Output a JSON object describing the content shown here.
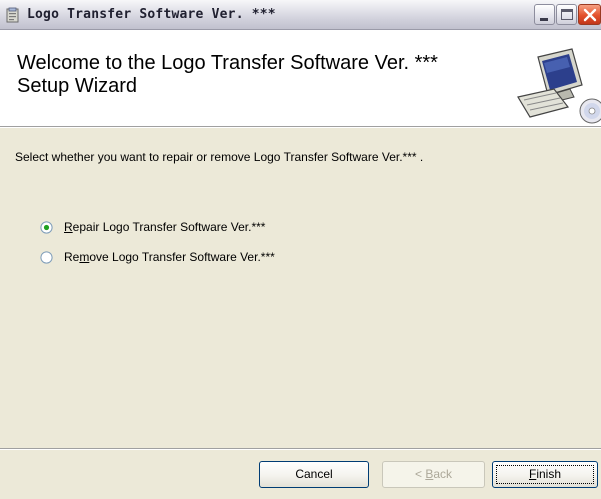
{
  "window": {
    "title": "Logo Transfer Software Ver. ***"
  },
  "titlebar_buttons": {
    "minimize": "minimize-icon",
    "maximize": "maximize-icon",
    "close": "close-icon"
  },
  "banner": {
    "title_line1": "Welcome to the Logo Transfer Software Ver. ***",
    "title_line2": "Setup Wizard",
    "graphic": "computer-setup-icon"
  },
  "body": {
    "instruction": "Select whether you want to repair or remove Logo Transfer Software Ver.*** .",
    "options": [
      {
        "label_pre": "",
        "label_key": "R",
        "label_post": "epair Logo Transfer Software Ver.***",
        "selected": true
      },
      {
        "label_pre": "Re",
        "label_key": "m",
        "label_post": "ove Logo Transfer Software Ver.***",
        "selected": false
      }
    ]
  },
  "footer": {
    "cancel": "Cancel",
    "back_pre": "< ",
    "back_key": "B",
    "back_post": "ack",
    "finish_key": "F",
    "finish_post": "inish"
  },
  "colors": {
    "dialog_bg": "#ece9d8",
    "banner_bg": "#ffffff",
    "button_border": "#003c74",
    "disabled_text": "#aca899",
    "close_button": "#e3512c"
  }
}
